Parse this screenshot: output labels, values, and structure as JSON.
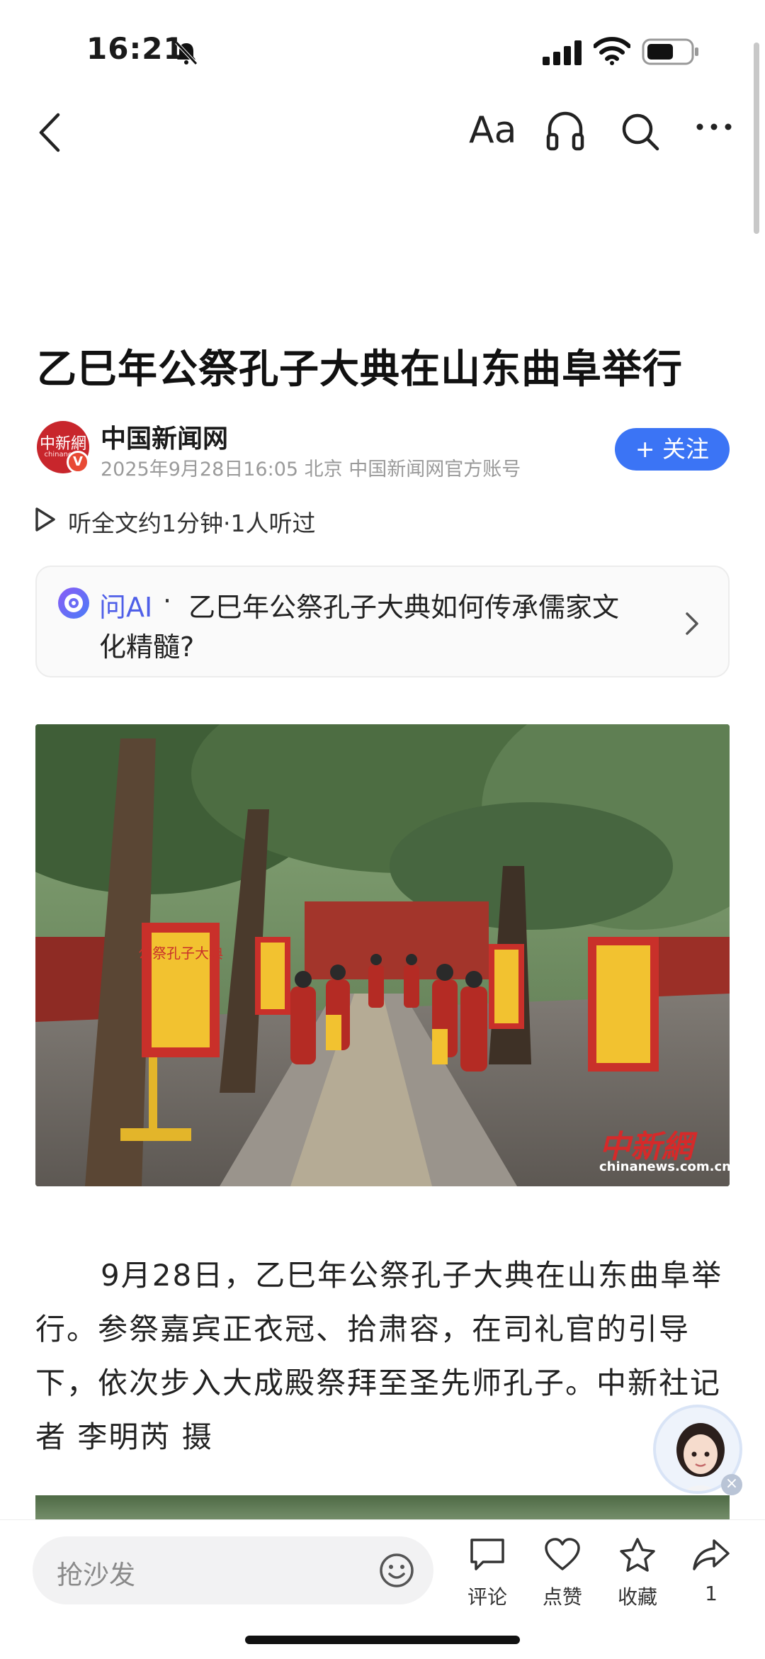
{
  "status_bar": {
    "time": "16:21"
  },
  "nav": {
    "font_label": "Aa",
    "icons": [
      "back-icon",
      "font-size-icon",
      "headphone-icon",
      "search-icon",
      "more-icon"
    ]
  },
  "article": {
    "title": "乙巳年公祭孔子大典在山东曲阜举行",
    "author": {
      "name": "中国新闻网",
      "avatar_text": "中新網",
      "avatar_sub": "chinanews",
      "badge": "V",
      "meta": "2025年9月28日16:05 北京 中国新闻网官方账号"
    },
    "follow_label": "+ 关注",
    "listen_text": "听全文约1分钟·1人听过",
    "ask_ai": {
      "label": "问AI",
      "separator": "·",
      "question_line1": "乙巳年公祭孔子大典如何传承儒家文",
      "question_line2": "化精髓?"
    },
    "photo": {
      "watermark": "中新網",
      "watermark_sub": "chinanews.com.cn",
      "banner_text": "公祭孔子大典"
    },
    "caption": "9月28日，乙巳年公祭孔子大典在山东曲阜举行。参祭嘉宾正衣冠、拾肃容，在司礼官的引导下，依次步入大成殿祭拜至圣先师孔子。中新社记者 李明芮 摄"
  },
  "bottom_bar": {
    "comment_placeholder": "抢沙发",
    "actions": {
      "comment": "评论",
      "like": "点赞",
      "favorite": "收藏",
      "share": "1"
    }
  },
  "colors": {
    "accent": "#3b74f5",
    "ai_purple": "#4f5fe8",
    "brand_red": "#c8262c"
  }
}
